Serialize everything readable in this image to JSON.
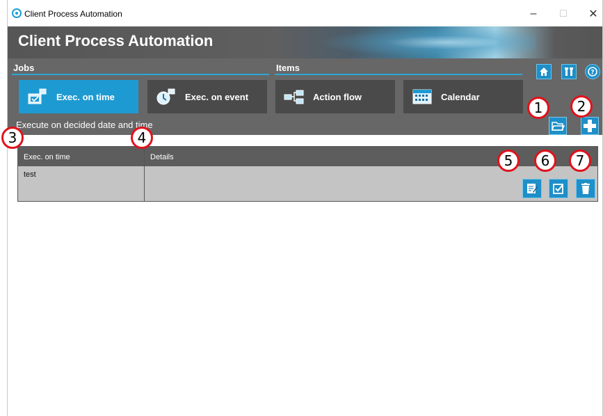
{
  "window": {
    "title": "Client Process Automation",
    "controls": {
      "minimize": "–",
      "maximize": "□",
      "close": "✕"
    }
  },
  "header": {
    "app_title": "Client Process Automation",
    "jobs_label": "Jobs",
    "items_label": "Items",
    "tabs": [
      {
        "label": "Exec. on time",
        "icon": "exec-on-time-icon",
        "active": true
      },
      {
        "label": "Exec. on event",
        "icon": "exec-on-event-icon",
        "active": false
      },
      {
        "label": "Action flow",
        "icon": "action-flow-icon",
        "active": false
      },
      {
        "label": "Calendar",
        "icon": "calendar-icon",
        "active": false
      }
    ],
    "top_icons": [
      "home-icon",
      "settings-icon",
      "help-icon"
    ],
    "subtitle": "Execute on decided date and time",
    "actions": [
      "open-folder-icon",
      "add-icon"
    ]
  },
  "table": {
    "columns": [
      "Exec. on time",
      "Details"
    ],
    "rows": [
      {
        "name": "test",
        "details": ""
      }
    ],
    "row_actions": [
      "edit-icon",
      "check-icon",
      "delete-icon"
    ]
  },
  "callouts": [
    "1",
    "2",
    "3",
    "4",
    "5",
    "6",
    "7"
  ],
  "colors": {
    "accent": "#1e9ad2",
    "header_bg": "#676767",
    "callout_border": "#e0121b"
  }
}
